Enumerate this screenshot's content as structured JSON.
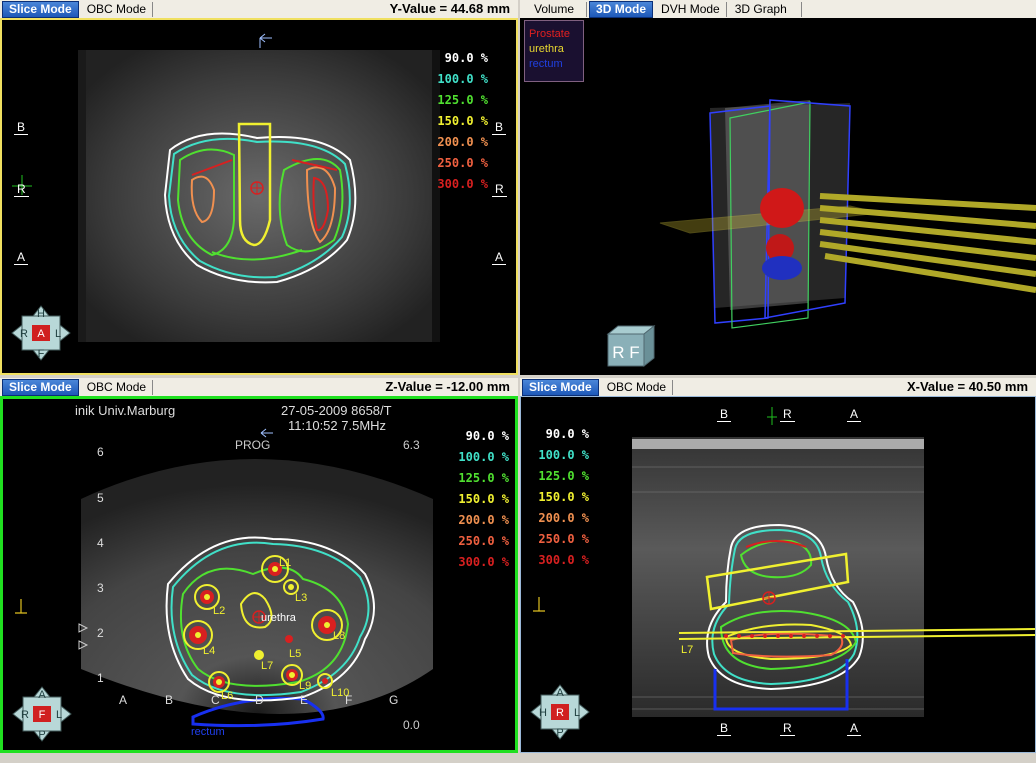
{
  "tabs_slice": {
    "slice": "Slice Mode",
    "obc": "OBC Mode"
  },
  "tabs_3d": {
    "volume": "Volume",
    "mode3d": "3D Mode",
    "dvh": "DVH Mode",
    "graph": "3D Graph"
  },
  "top_left": {
    "value": "Y-Value = 44.68 mm",
    "dirs": {
      "top_b": "B",
      "mid_r": "R",
      "bot_a": "A",
      "right_b": "B",
      "right_r": "R",
      "right_a": "A"
    },
    "nav": {
      "top": "H",
      "left": "R",
      "center": "A",
      "right": "L",
      "bottom": "F"
    }
  },
  "top_right": {
    "legend": [
      {
        "label": "Prostate",
        "color": "#e02020"
      },
      {
        "label": "urethra",
        "color": "#e8d830"
      },
      {
        "label": "rectum",
        "color": "#2040e0"
      }
    ],
    "cube": "R F"
  },
  "bottom_left": {
    "value": "Z-Value = -12.00 mm",
    "header1": "inik Univ.Marburg",
    "header2": "27-05-2009 8658/T",
    "header3": "11:10:52 7.5MHz",
    "prog": "PROG",
    "depth": "6.3",
    "depth0": "0.0",
    "yticks": [
      "6",
      "5",
      "4",
      "3",
      "2",
      "1"
    ],
    "xticks": [
      "A",
      "B",
      "C",
      "D",
      "E",
      "F",
      "G"
    ],
    "needles": [
      "L1",
      "L2",
      "L3",
      "L4",
      "L5",
      "L6",
      "L7",
      "L8",
      "L9",
      "L10"
    ],
    "urethra_label": "urethra",
    "rectum_label": "rectum",
    "nav": {
      "top": "A",
      "left": "R",
      "center": "F",
      "right": "L",
      "bottom": "P"
    }
  },
  "bottom_right": {
    "value": "X-Value = 40.50 mm",
    "top_dirs": [
      "B",
      "R",
      "A"
    ],
    "bot_dirs": [
      "B",
      "R",
      "A"
    ],
    "needle": "L7",
    "nav": {
      "top": "A",
      "left": "H",
      "center": "R",
      "right": "L",
      "bottom": "P"
    }
  },
  "isodose": [
    {
      "label": "90.0 %",
      "color": "#ffffff"
    },
    {
      "label": "100.0 %",
      "color": "#40e0c8"
    },
    {
      "label": "125.0 %",
      "color": "#50e030"
    },
    {
      "label": "150.0 %",
      "color": "#f0f030"
    },
    {
      "label": "200.0 %",
      "color": "#f09050"
    },
    {
      "label": "250.0 %",
      "color": "#f06040"
    },
    {
      "label": "300.0 %",
      "color": "#d82020"
    }
  ]
}
